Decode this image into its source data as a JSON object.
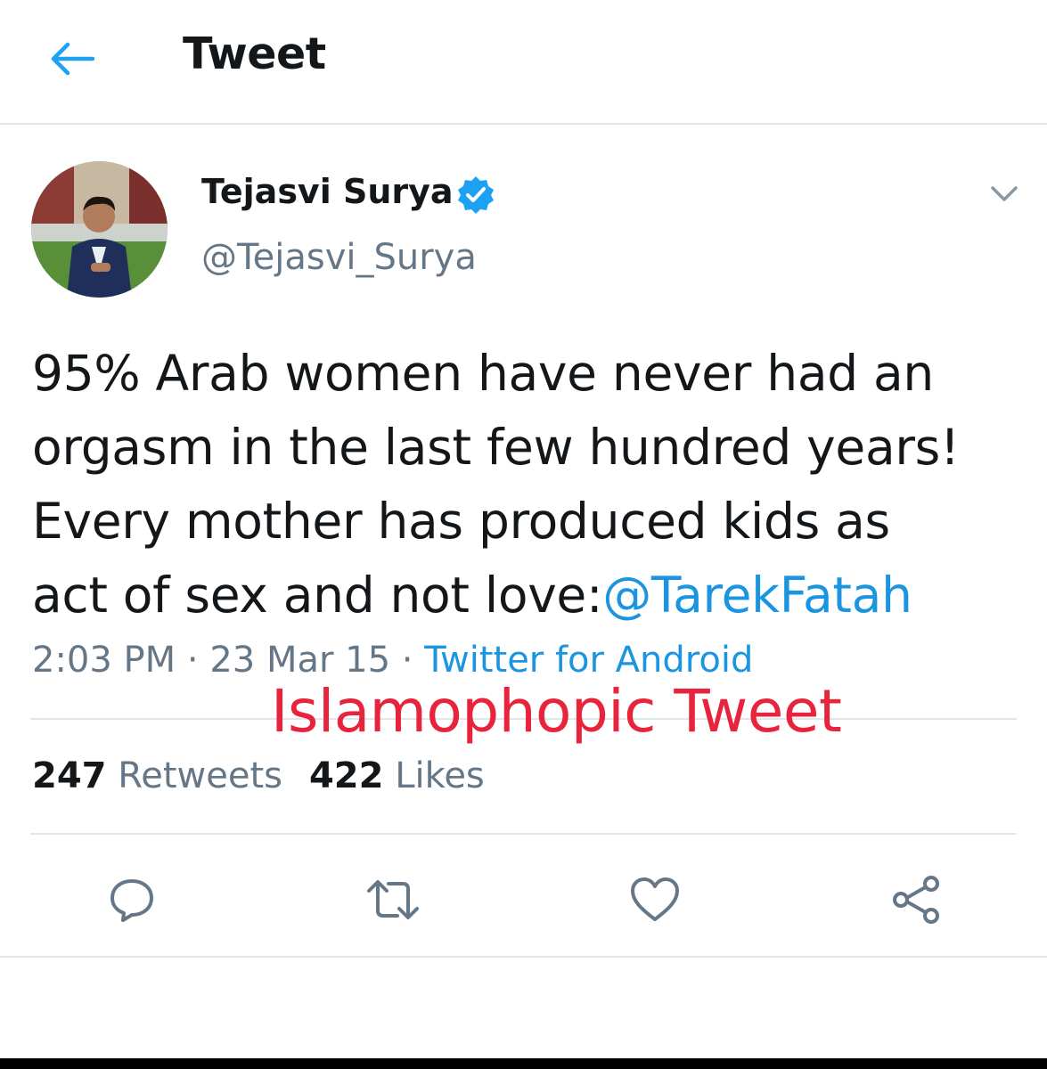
{
  "header": {
    "back_icon": "arrow-left-icon",
    "title": "Tweet"
  },
  "author": {
    "name": "Tejasvi Surya",
    "handle": "@Tejasvi_Surya",
    "verified_icon": "verified-badge-icon",
    "caret_icon": "chevron-down-icon"
  },
  "tweet": {
    "lines": [
      "95% Arab women have never had an",
      "orgasm in the last few hundred years!",
      "Every mother has produced kids as",
      "act of sex and not love:"
    ],
    "mention": "@TarekFatah",
    "time": "2:03 PM",
    "date": "23 Mar 15",
    "separator": "·",
    "source": "Twitter for Android"
  },
  "overlay_label": "Islamophopic Tweet",
  "stats": {
    "retweets_count": "247",
    "retweets_label": "Retweets",
    "likes_count": "422",
    "likes_label": "Likes"
  },
  "actions": [
    {
      "icon": "reply-icon"
    },
    {
      "icon": "retweet-icon"
    },
    {
      "icon": "heart-icon"
    },
    {
      "icon": "share-icon"
    }
  ],
  "colors": {
    "link": "#1b95e0",
    "verified": "#1da1f2",
    "secondary_text": "#657786",
    "overlay_text": "#e8243c",
    "divider": "#e1e6ea"
  }
}
